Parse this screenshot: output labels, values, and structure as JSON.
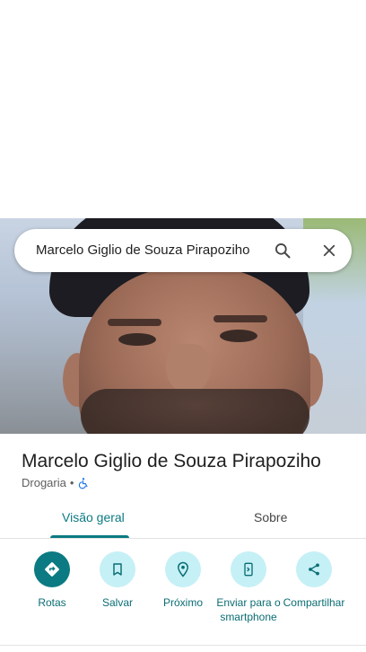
{
  "search": {
    "query": "Marcelo Giglio de Souza Pirapoziho"
  },
  "place": {
    "name": "Marcelo Giglio de Souza Pirapoziho",
    "category": "Drogaria",
    "separator": "•",
    "accessibility_icon": "wheelchair-icon"
  },
  "tabs": [
    {
      "label": "Visão geral",
      "active": true
    },
    {
      "label": "Sobre",
      "active": false
    }
  ],
  "actions": [
    {
      "label": "Rotas",
      "icon": "directions-icon"
    },
    {
      "label": "Salvar",
      "icon": "bookmark-icon"
    },
    {
      "label": "Próximo",
      "icon": "nearby-icon"
    },
    {
      "label": "Enviar para o smartphone",
      "icon": "send-to-phone-icon"
    },
    {
      "label": "Compartilhar",
      "icon": "share-icon"
    }
  ],
  "colors": {
    "accent": "#0b7a82",
    "action_bg": "#c5f0f6",
    "accessibility": "#1a73e8"
  }
}
